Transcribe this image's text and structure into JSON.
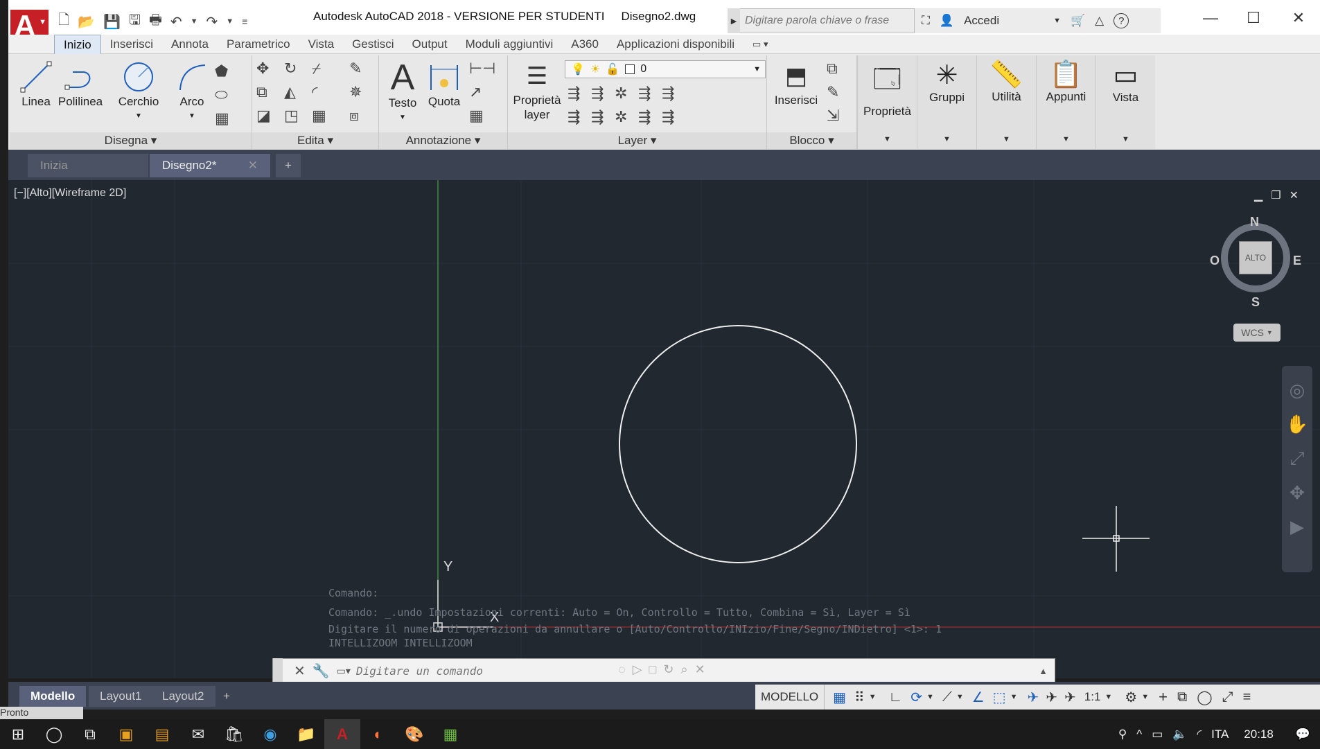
{
  "titlebar": {
    "app_title": "Autodesk AutoCAD 2018 - VERSIONE PER STUDENTI",
    "file_name": "Disegno2.dwg",
    "search_placeholder": "Digitare parola chiave o frase",
    "signin_label": "Accedi",
    "logo_letter": "A"
  },
  "ribbon_tabs": [
    "Inizio",
    "Inserisci",
    "Annota",
    "Parametrico",
    "Vista",
    "Gestisci",
    "Output",
    "Moduli aggiuntivi",
    "A360",
    "Applicazioni disponibili"
  ],
  "draw_panel": {
    "title": "Disegna",
    "line": "Linea",
    "polyline": "Polilinea",
    "circle": "Cerchio",
    "arc": "Arco"
  },
  "modify_panel": {
    "title": "Edita"
  },
  "annotation_panel": {
    "title": "Annotazione",
    "text": "Testo",
    "dimension": "Quota"
  },
  "layer_panel": {
    "title": "Layer",
    "properties_line1": "Proprietà",
    "properties_line2": "layer",
    "current_layer": "0"
  },
  "block_panel": {
    "title": "Blocco",
    "insert": "Inserisci"
  },
  "big_panels": {
    "properties": "Proprietà",
    "groups": "Gruppi",
    "utilities": "Utilità",
    "clipboard": "Appunti",
    "view": "Vista"
  },
  "doc_tabs": {
    "start": "Inizia",
    "current": "Disegno2*",
    "new": "+"
  },
  "viewport": {
    "label": "[−][Alto][Wireframe 2D]",
    "viewcube_top": "ALTO",
    "compass_n": "N",
    "compass_s": "S",
    "compass_e": "E",
    "compass_w": "O",
    "wcs": "WCS",
    "ucs_y": "Y",
    "ucs_x": "X"
  },
  "command_history": [
    "Comando:",
    "Comando: _.undo Impostazioni correnti: Auto = On, Controllo = Tutto, Combina = Sì, Layer = Sì",
    "Digitare il numero di operazioni da annullare o [Auto/Controllo/INIzio/Fine/Segno/INDietro] <1>: 1",
    "INTELLIZOOM INTELLIZOOM"
  ],
  "command_input": {
    "placeholder": "Digitare un comando"
  },
  "layout_tabs": [
    "Modello",
    "Layout1",
    "Layout2"
  ],
  "layout_add": "+",
  "status": {
    "mode": "MODELLO",
    "scale": "1:1",
    "ready": "Pronto"
  },
  "taskbar": {
    "language": "ITA",
    "time": "20:18"
  },
  "colors": {
    "accent": "#c62026",
    "canvas": "#212830",
    "y_axis": "#3d8a3d",
    "x_axis": "#8a2b2b"
  }
}
